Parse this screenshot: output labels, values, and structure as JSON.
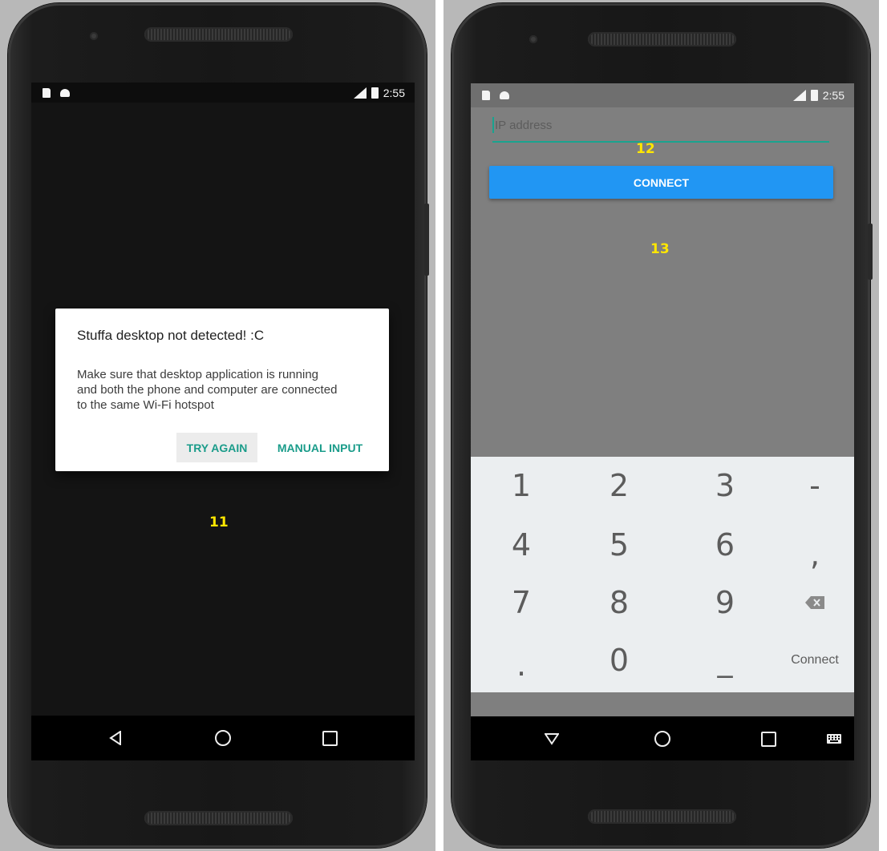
{
  "left_phone": {
    "status": {
      "time": "2:55"
    },
    "dialog": {
      "title": "Stuffa desktop not detected! :C",
      "message": "Make sure that desktop application is running and both the phone and computer are connected to the same Wi-Fi hotspot",
      "buttons": {
        "try_again": "TRY AGAIN",
        "manual_input": "MANUAL INPUT"
      }
    },
    "annotation": "11"
  },
  "right_phone": {
    "status": {
      "time": "2:55"
    },
    "ip_field": {
      "placeholder": "IP address"
    },
    "annotation_field": "12",
    "connect_button": "CONNECT",
    "annotation_button": "13",
    "keypad": {
      "rows": [
        [
          "1",
          "2",
          "3",
          "-"
        ],
        [
          "4",
          "5",
          "6",
          ","
        ],
        [
          "7",
          "8",
          "9",
          "backspace-icon"
        ],
        [
          ".",
          "0",
          "_",
          "Connect"
        ]
      ]
    }
  },
  "colors": {
    "accent_teal": "#1a9c8a",
    "button_blue": "#2196f3",
    "annotation_yellow": "#ffe600"
  }
}
